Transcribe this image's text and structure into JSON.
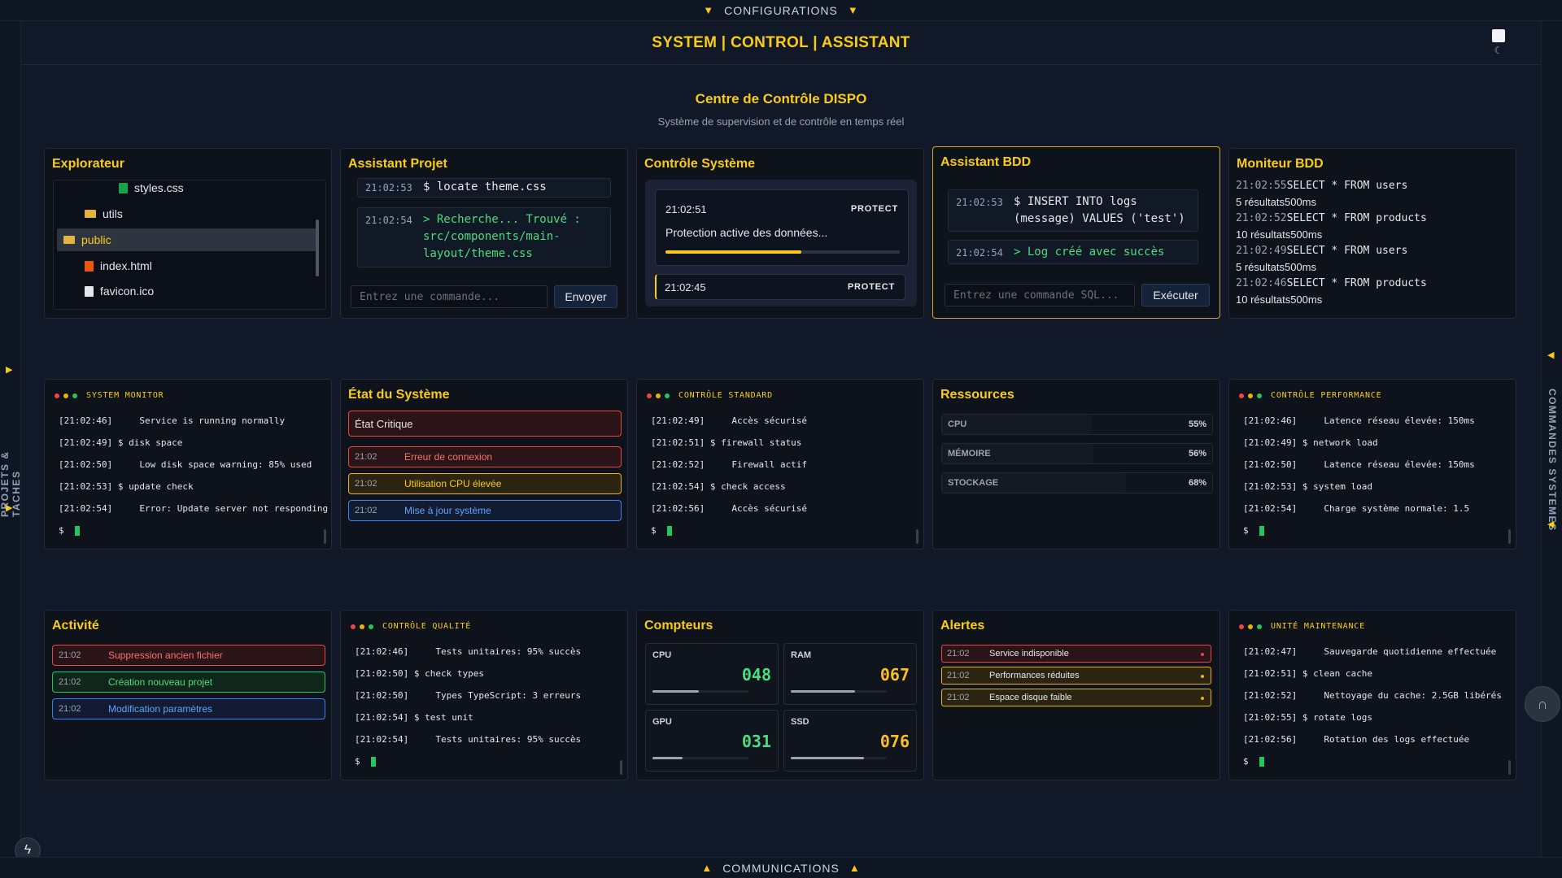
{
  "config_bar": {
    "label": "CONFIGURATIONS"
  },
  "header": {
    "title": "SYSTEM | CONTROL | ASSISTANT"
  },
  "side_left": {
    "label": "PROJETS & TACHES"
  },
  "side_right": {
    "label": "COMMANDES SYSTEMES"
  },
  "bottom_bar": {
    "label": "COMMUNICATIONS"
  },
  "page": {
    "title": "Centre de Contrôle DISPO",
    "subtitle": "Système de supervision et de contrôle en temps réel"
  },
  "explorer": {
    "title": "Explorateur",
    "items": [
      {
        "label": "styles.css",
        "type": "file",
        "color": "#16a34a"
      },
      {
        "label": "utils",
        "type": "folder"
      },
      {
        "label": "public",
        "type": "folder",
        "selected": true
      },
      {
        "label": "index.html",
        "type": "file",
        "color": "#ea580c"
      },
      {
        "label": "favicon.ico",
        "type": "file",
        "color": "#e5e7eb"
      }
    ]
  },
  "assistant_projet": {
    "title": "Assistant Projet",
    "messages": [
      {
        "time": "21:02:53",
        "text": "$ locate theme.css"
      },
      {
        "time": "21:02:54",
        "text": "> Recherche... Trouvé : src/components/main-layout/theme.css"
      }
    ],
    "input_placeholder": "Entrez une commande...",
    "send_label": "Envoyer"
  },
  "controle_systeme": {
    "title": "Contrôle Système",
    "cards": [
      {
        "time": "21:02:51",
        "tag": "PROTECT",
        "text": "Protection active des données...",
        "progress": 0.58
      },
      {
        "time": "21:02:45",
        "tag": "PROTECT"
      }
    ]
  },
  "assistant_bdd": {
    "title": "Assistant BDD",
    "messages": [
      {
        "time": "21:02:53",
        "text": "$ INSERT INTO logs (message) VALUES ('test')"
      },
      {
        "time": "21:02:54",
        "text": "> Log créé avec succès"
      }
    ],
    "input_placeholder": "Entrez une commande SQL...",
    "exec_label": "Exécuter"
  },
  "moniteur_bdd": {
    "title": "Moniteur BDD",
    "lines": [
      {
        "time": "21:02:55",
        "text": "SELECT * FROM users"
      },
      {
        "time": "",
        "text": "5 résultats500ms"
      },
      {
        "time": "21:02:52",
        "text": "SELECT * FROM products"
      },
      {
        "time": "",
        "text": "10 résultats500ms"
      },
      {
        "time": "21:02:49",
        "text": "SELECT * FROM users"
      },
      {
        "time": "",
        "text": "5 résultats500ms"
      },
      {
        "time": "21:02:46",
        "text": "SELECT * FROM products"
      },
      {
        "time": "",
        "text": "10 résultats500ms"
      }
    ]
  },
  "system_monitor": {
    "title": "SYSTEM MONITOR",
    "lines": [
      "[21:02:46]     Service is running normally",
      "[21:02:49] $ disk space",
      "[21:02:50]     Low disk space warning: 85% used",
      "[21:02:53] $ update check",
      "[21:02:54]     Error: Update server not responding"
    ],
    "prompt": "$"
  },
  "etat_systeme": {
    "title": "État du Système",
    "header": "État Critique",
    "items": [
      {
        "time": "21:02",
        "text": "Erreur de connexion",
        "level": "error"
      },
      {
        "time": "21:02",
        "text": "Utilisation CPU élevée",
        "level": "warning"
      },
      {
        "time": "21:02",
        "text": "Mise à jour système",
        "level": "info"
      }
    ]
  },
  "controle_standard": {
    "title": "CONTRÔLE STANDARD",
    "lines": [
      "[21:02:49]     Accès sécurisé",
      "[21:02:51] $ firewall status",
      "[21:02:52]     Firewall actif",
      "[21:02:54] $ check access",
      "[21:02:56]     Accès sécurisé"
    ],
    "prompt": "$"
  },
  "ressources": {
    "title": "Ressources",
    "items": [
      {
        "label": "CPU",
        "percent_text": "55%",
        "value": 0.55
      },
      {
        "label": "MÉMOIRE",
        "percent_text": "56%",
        "value": 0.56
      },
      {
        "label": "STOCKAGE",
        "percent_text": "68%",
        "value": 0.68
      }
    ]
  },
  "controle_performance": {
    "title": "CONTRÔLE PERFORMANCE",
    "lines": [
      "[21:02:46]     Latence réseau élevée: 150ms",
      "[21:02:49] $ network load",
      "[21:02:50]     Latence réseau élevée: 150ms",
      "[21:02:53] $ system load",
      "[21:02:54]     Charge système normale: 1.5"
    ],
    "prompt": "$"
  },
  "activite": {
    "title": "Activité",
    "items": [
      {
        "time": "21:02",
        "text": "Suppression ancien fichier",
        "level": "error"
      },
      {
        "time": "21:02",
        "text": "Création nouveau projet",
        "level": "success"
      },
      {
        "time": "21:02",
        "text": "Modification paramètres",
        "level": "info"
      }
    ]
  },
  "controle_qualite": {
    "title": "CONTRÔLE QUALITÉ",
    "lines": [
      "[21:02:46]     Tests unitaires: 95% succès",
      "[21:02:50] $ check types",
      "[21:02:50]     Types TypeScript: 3 erreurs",
      "[21:02:54] $ test unit",
      "[21:02:54]     Tests unitaires: 95% succès"
    ],
    "prompt": "$"
  },
  "compteurs": {
    "title": "Compteurs",
    "items": [
      {
        "label": "CPU",
        "value": "048",
        "color": "#4ade80",
        "level": 0.48
      },
      {
        "label": "RAM",
        "value": "067",
        "color": "#fbbf24",
        "level": 0.67
      },
      {
        "label": "GPU",
        "value": "031",
        "color": "#4ade80",
        "level": 0.31
      },
      {
        "label": "SSD",
        "value": "076",
        "color": "#fbbf24",
        "level": 0.76
      }
    ]
  },
  "alertes": {
    "title": "Alertes",
    "items": [
      {
        "time": "21:02",
        "text": "Service indisponible",
        "level": "error"
      },
      {
        "time": "21:02",
        "text": "Performances réduites",
        "level": "warning"
      },
      {
        "time": "21:02",
        "text": "Espace disque faible",
        "level": "warning"
      }
    ]
  },
  "unite_maintenance": {
    "title": "UNITÉ MAINTENANCE",
    "lines": [
      "[21:02:47]     Sauvegarde quotidienne effectuée",
      "[21:02:51] $ clean cache",
      "[21:02:52]     Nettoyage du cache: 2.5GB libérés",
      "[21:02:55] $ rotate logs",
      "[21:02:56]     Rotation des logs effectuée"
    ],
    "prompt": "$"
  },
  "colors": {
    "accent": "#facc15",
    "error": "#ef4444",
    "warning": "#eab308",
    "info": "#3b82f6",
    "success": "#22c55e"
  }
}
